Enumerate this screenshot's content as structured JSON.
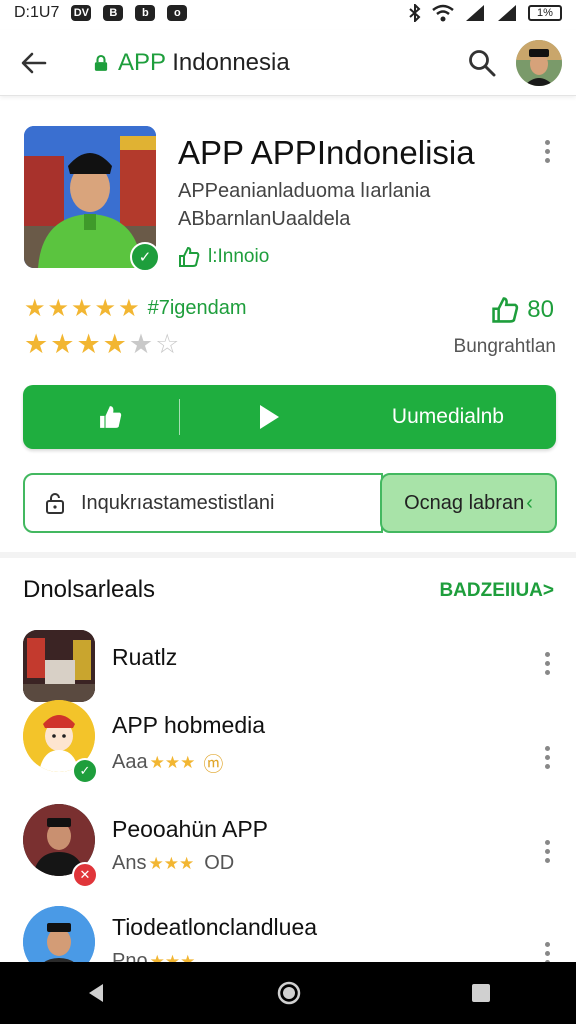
{
  "status_bar": {
    "time": "D:1U7",
    "app_badges": [
      "DV",
      "B",
      "b",
      "o"
    ],
    "battery": "1%"
  },
  "app_bar": {
    "title_prefix": "APP",
    "title_rest": " Indonnesia"
  },
  "app": {
    "title": "APP APPIndonelisia",
    "subtitle_1": "APPeanianladuoma lıarlania",
    "subtitle_2": "ABbarnlanUaaldela",
    "verified_label": "l:Innoio"
  },
  "ratings": {
    "row1_stars": 5,
    "row1_label": "#7igendam",
    "row2_stars": 4,
    "likes_count": "80",
    "likes_label": "Bungrahtlan"
  },
  "primary_button": {
    "label": "Uumedialnb"
  },
  "search": {
    "placeholder": "Inqukrıastamestistlani",
    "button_label": "Ocnag labran",
    "button_chevron": "‹"
  },
  "section": {
    "title": "Dnolsarleals",
    "more_label": "BADZEIIUA>",
    "items": [
      {
        "title": "Ruatlz",
        "meta": "",
        "stars": 0,
        "extra": ""
      },
      {
        "title": "APP hobmedia",
        "meta": "Aaa",
        "stars": 3,
        "extra": "ⓜ",
        "badge": "✓"
      },
      {
        "title": "Peooahün APP",
        "meta": "Ans",
        "stars": 3,
        "extra": "OD",
        "badge": "✕"
      },
      {
        "title": "Tiodeatlonclandluea",
        "meta": "Pno",
        "stars": 3,
        "extra": "",
        "badge": ""
      }
    ]
  },
  "colors": {
    "brand_green": "#1fae3f",
    "light_green": "#a8e3a8",
    "star": "#f2b632"
  }
}
